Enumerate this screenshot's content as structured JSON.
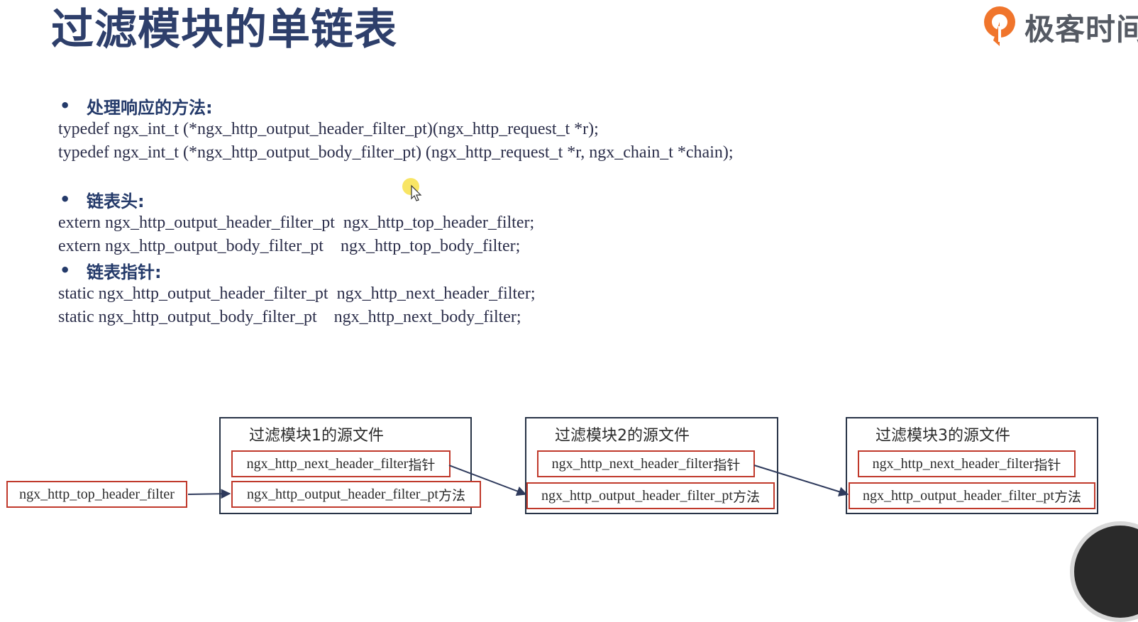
{
  "title": "过滤模块的单链表",
  "logo": {
    "icon": "geekbang-logo-icon",
    "text": "极客时间",
    "color": "#f0752c"
  },
  "sections": [
    {
      "heading": "处理响应的方法:",
      "lines": [
        "typedef ngx_int_t (*ngx_http_output_header_filter_pt)(ngx_http_request_t *r);",
        "typedef ngx_int_t (*ngx_http_output_body_filter_pt) (ngx_http_request_t *r, ngx_chain_t *chain);"
      ]
    },
    {
      "heading": "链表头:",
      "lines": [
        "extern ngx_http_output_header_filter_pt  ngx_http_top_header_filter;",
        "extern ngx_http_output_body_filter_pt    ngx_http_top_body_filter;"
      ]
    },
    {
      "heading": "链表指针:",
      "lines": [
        "static ngx_http_output_header_filter_pt  ngx_http_next_header_filter;",
        "static ngx_http_output_body_filter_pt    ngx_http_next_body_filter;"
      ]
    }
  ],
  "diagram": {
    "head": "ngx_http_top_header_filter",
    "modules": [
      {
        "title": "过滤模块1的源文件",
        "next_var": "ngx_http_next_header_filter",
        "next_suffix": "指针",
        "method_var": "ngx_http_output_header_filter_pt",
        "method_suffix": "方法"
      },
      {
        "title": "过滤模块2的源文件",
        "next_var": "ngx_http_next_header_filter",
        "next_suffix": "指针",
        "method_var": "ngx_http_output_header_filter_pt",
        "method_suffix": "方法"
      },
      {
        "title": "过滤模块3的源文件",
        "next_var": "ngx_http_next_header_filter",
        "next_suffix": "指针",
        "method_var": "ngx_http_output_header_filter_pt",
        "method_suffix": "方法"
      }
    ],
    "colors": {
      "box_border": "#283447",
      "item_border": "#c0392b",
      "arrow": "#2e3a5c"
    }
  }
}
